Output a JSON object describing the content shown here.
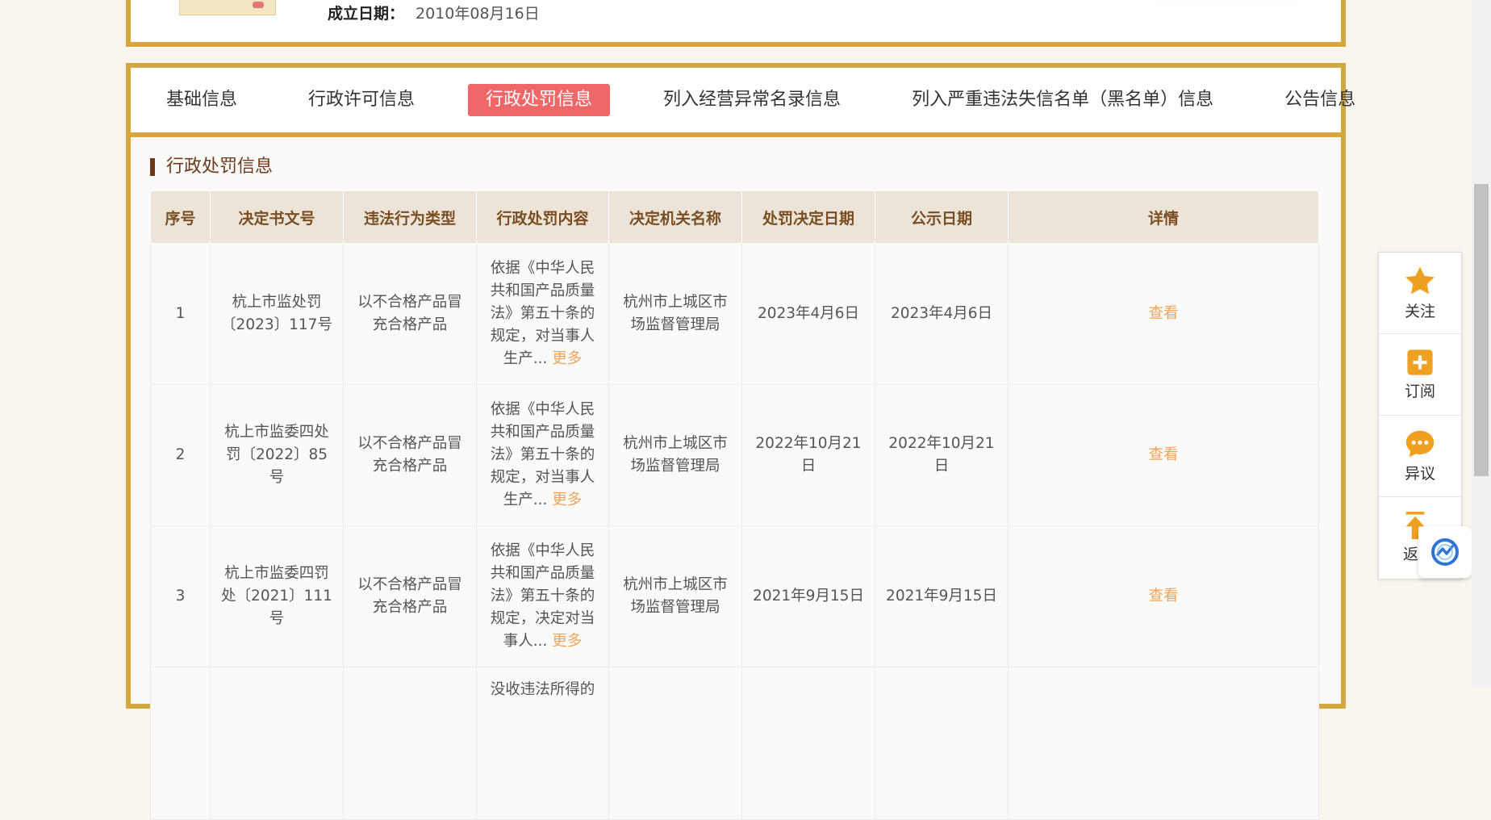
{
  "company": {
    "established_label": "成立日期：",
    "established_value": "2010年08月16日"
  },
  "tabs": [
    {
      "label": "基础信息",
      "active": false
    },
    {
      "label": "行政许可信息",
      "active": false
    },
    {
      "label": "行政处罚信息",
      "active": true
    },
    {
      "label": "列入经营异常名录信息",
      "active": false
    },
    {
      "label": "列入严重违法失信名单（黑名单）信息",
      "active": false
    },
    {
      "label": "公告信息",
      "active": false
    }
  ],
  "section_title": "行政处罚信息",
  "table": {
    "headers": [
      "序号",
      "决定书文号",
      "违法行为类型",
      "行政处罚内容",
      "决定机关名称",
      "处罚决定日期",
      "公示日期",
      "详情"
    ],
    "rows": [
      {
        "no": "1",
        "doc_no": "杭上市监处罚〔2023〕117号",
        "type": "以不合格产品冒充合格产品",
        "content": "依据《中华人民共和国产品质量法》第五十条的规定，对当事人生产...",
        "more": "更多",
        "authority": "杭州市上城区市场监督管理局",
        "decision_date": "2023年4月6日",
        "publish_date": "2023年4月6日",
        "detail": "查看"
      },
      {
        "no": "2",
        "doc_no": "杭上市监委四处罚〔2022〕85号",
        "type": "以不合格产品冒充合格产品",
        "content": "依据《中华人民共和国产品质量法》第五十条的规定，对当事人生产...",
        "more": "更多",
        "authority": "杭州市上城区市场监督管理局",
        "decision_date": "2022年10月21日",
        "publish_date": "2022年10月21日",
        "detail": "查看"
      },
      {
        "no": "3",
        "doc_no": "杭上市监委四罚处〔2021〕111号",
        "type": "以不合格产品冒充合格产品",
        "content": "依据《中华人民共和国产品质量法》第五十条的规定，决定对当事人...",
        "more": "更多",
        "authority": "杭州市上城区市场监督管理局",
        "decision_date": "2021年9月15日",
        "publish_date": "2021年9月15日",
        "detail": "查看"
      }
    ],
    "partial_row_text": "没收违法所得的"
  },
  "float_panel": [
    {
      "label": "关注",
      "icon": "star-icon"
    },
    {
      "label": "订阅",
      "icon": "plus-square-icon"
    },
    {
      "label": "异议",
      "icon": "chat-bubble-icon"
    },
    {
      "label": "返",
      "icon": "arrow-up-icon"
    }
  ],
  "colors": {
    "border_gold": "#d4a640",
    "active_tab": "#ef6767",
    "link_orange": "#f0a35a",
    "icon_orange": "#f0a020"
  }
}
